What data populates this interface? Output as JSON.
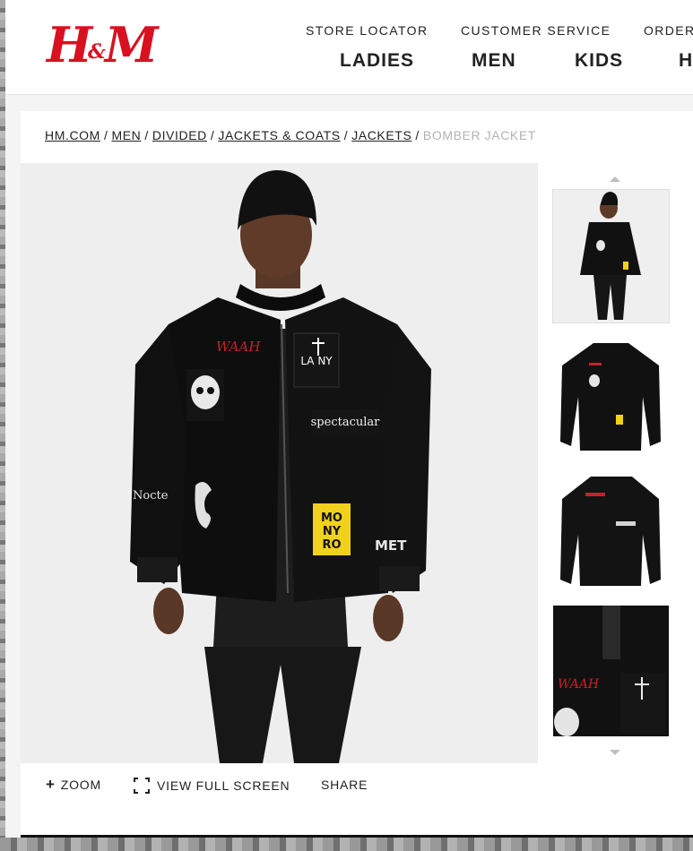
{
  "header": {
    "logo": "H&M",
    "top_links": [
      "STORE LOCATOR",
      "CUSTOMER SERVICE",
      "ORDER"
    ],
    "nav": [
      "LADIES",
      "MEN",
      "KIDS",
      "H"
    ]
  },
  "breadcrumb": {
    "items": [
      "HM.COM",
      "MEN",
      "DIVIDED",
      "JACKETS & COATS",
      "JACKETS"
    ],
    "separator": "/",
    "current": "BOMBER JACKET"
  },
  "product": {
    "patches": {
      "red_script": "WAAH",
      "cross_patch": "LA NY",
      "gothic_text": "spectacular",
      "yellow_patch": [
        "MO",
        "NY",
        "RO"
      ],
      "sleeve_left": "Nocte",
      "sleeve_right": "MET"
    },
    "thumbnails_count": 4
  },
  "actions": {
    "zoom": "ZOOM",
    "full_screen": "VIEW FULL SCREEN",
    "share": "SHARE"
  },
  "colors": {
    "brand_red": "#d8101f",
    "text": "#222222",
    "breadcrumb_current": "#b3b3b3",
    "patch_yellow": "#f0d21b"
  }
}
